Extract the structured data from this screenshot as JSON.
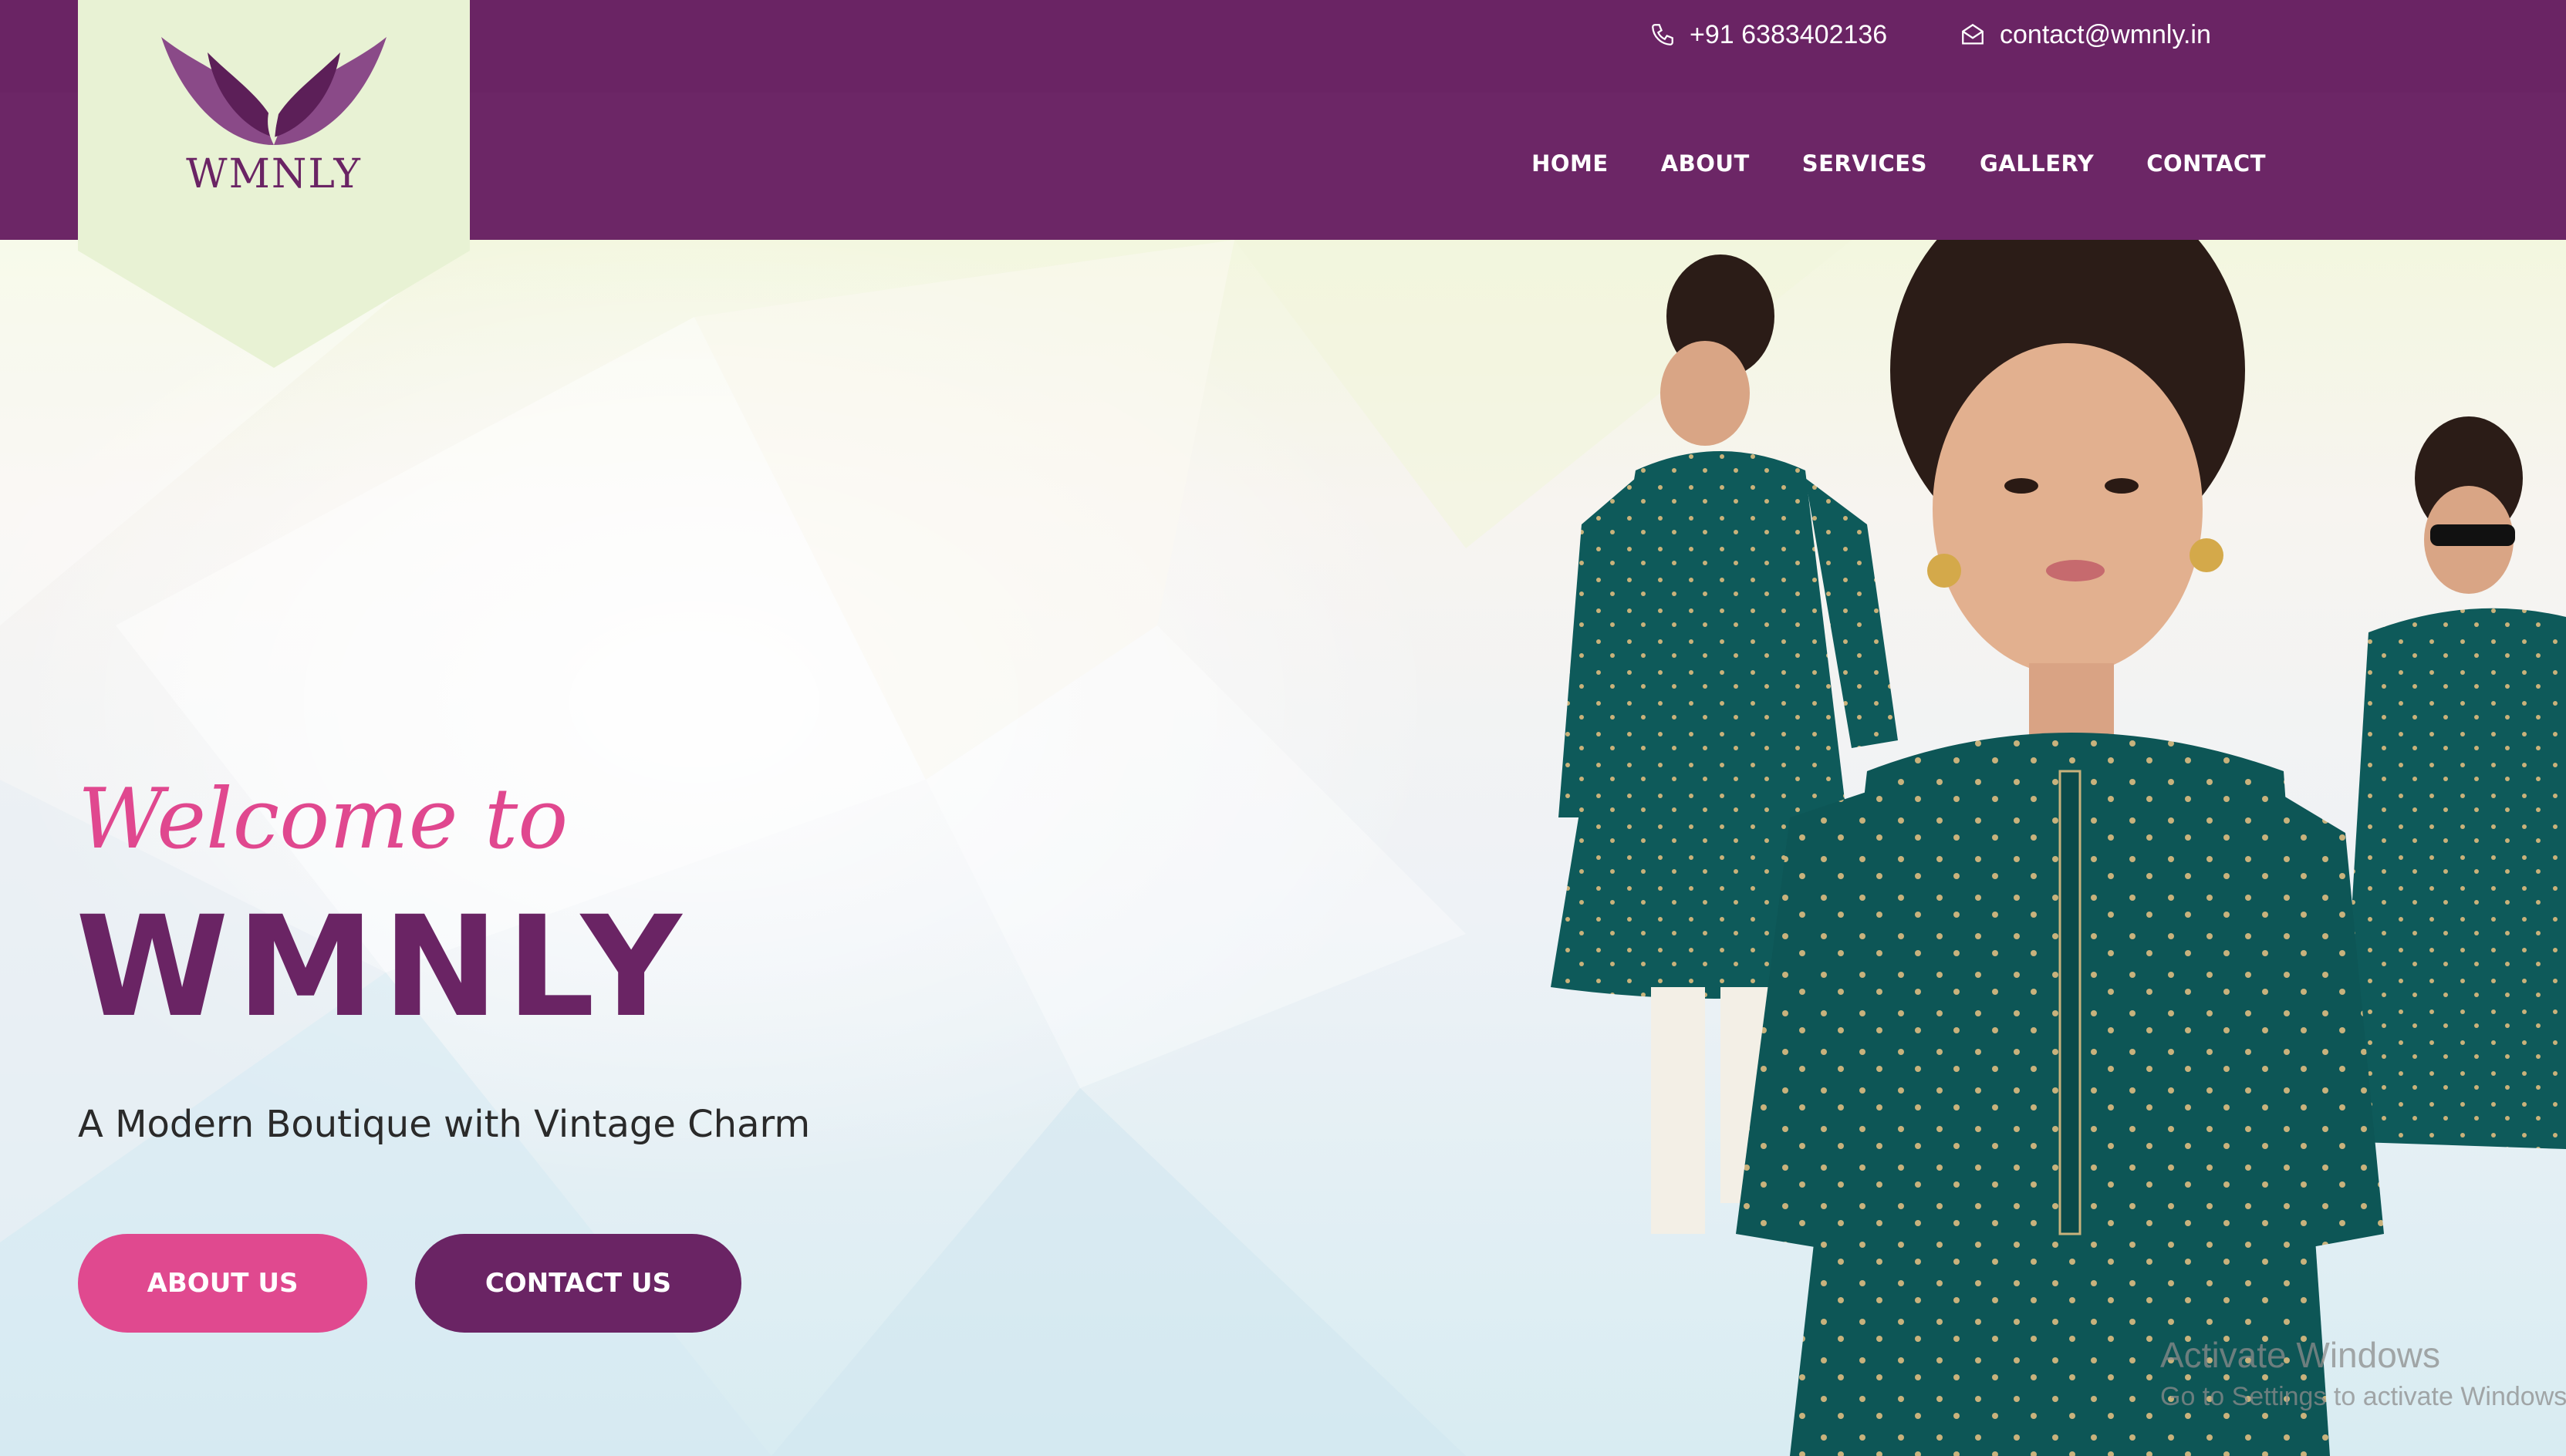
{
  "brand": {
    "logo_text": "WMNLY",
    "colors": {
      "primary": "#6a2464",
      "accent": "#e0498f",
      "logo_bg": "#e8f2d4"
    }
  },
  "topbar": {
    "phone": "+91 6383402136",
    "phone_icon": "phone-icon",
    "email": "contact@wmnly.in",
    "email_icon": "mail-icon"
  },
  "nav": {
    "items": [
      {
        "label": "HOME"
      },
      {
        "label": "ABOUT"
      },
      {
        "label": "SERVICES"
      },
      {
        "label": "GALLERY"
      },
      {
        "label": "CONTACT"
      }
    ]
  },
  "hero": {
    "welcome": "Welcome to",
    "title": "WMNLY",
    "tagline": "A Modern Boutique with Vintage Charm",
    "buttons": {
      "about": "ABOUT US",
      "contact": "CONTACT US"
    }
  },
  "os_watermark": {
    "title": "Activate Windows",
    "subtitle": "Go to Settings to activate Windows."
  }
}
